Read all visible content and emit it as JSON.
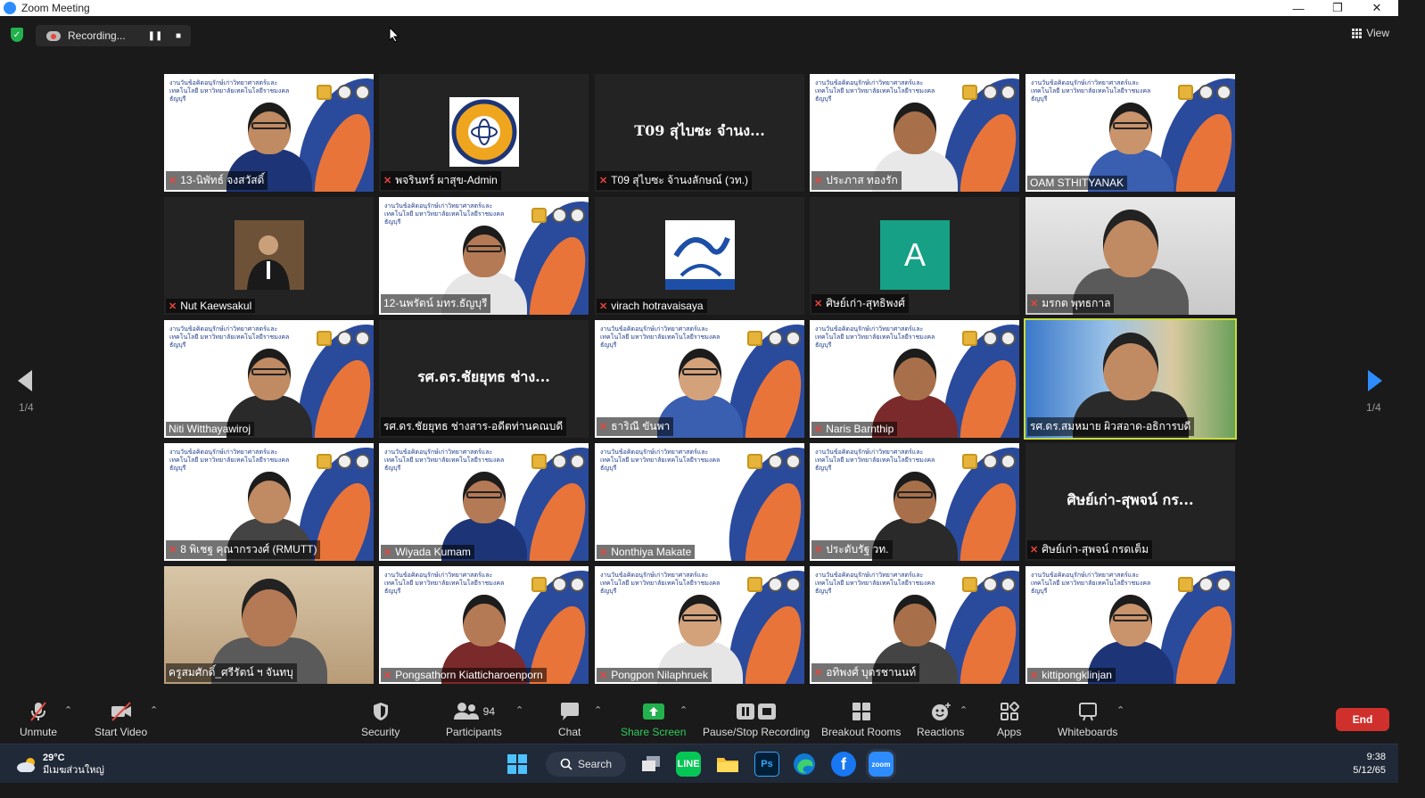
{
  "window": {
    "title": "Zoom Meeting"
  },
  "recording": {
    "status": "Recording..."
  },
  "view": {
    "label": "View"
  },
  "pagination": {
    "left": "1/4",
    "right": "1/4"
  },
  "participants": [
    {
      "name": "13-นิพัทธ์ จงสวัสดิ์",
      "muted": true,
      "kind": "slide-person"
    },
    {
      "name": "พจรินทร์ ผาสุข-Admin",
      "muted": true,
      "kind": "logo"
    },
    {
      "name": "T09 สุไบซะ จ้านงลักษณ์ (วท.)",
      "muted": true,
      "kind": "name-card",
      "card": "T09 สุไบซะ จำนง..."
    },
    {
      "name": "ประภาส ทองรัก",
      "muted": true,
      "kind": "slide-person"
    },
    {
      "name": "OAM STHITYANAK",
      "muted": false,
      "kind": "slide-person"
    },
    {
      "name": "Nut Kaewsakul",
      "muted": true,
      "kind": "photo"
    },
    {
      "name": "12-นพรัตน์ มทร.ธัญบุรี",
      "muted": false,
      "kind": "slide-person"
    },
    {
      "name": "virach hotravaisaya",
      "muted": true,
      "kind": "logo2"
    },
    {
      "name": "ศิษย์เก่า-สุทธิพงศ์",
      "muted": true,
      "kind": "avatar",
      "initial": "A"
    },
    {
      "name": "มรกต พุทธกาล",
      "muted": true,
      "kind": "camera"
    },
    {
      "name": "Niti Witthayawiroj",
      "muted": false,
      "kind": "slide-person"
    },
    {
      "name": "รศ.ดร.ชัยยุทธ ช่างสาร-อดีตท่านคณบดี",
      "muted": false,
      "kind": "name-card",
      "card": "รศ.ดร.ชัยยุทธ ช่าง..."
    },
    {
      "name": "ธาริณี ขันพา",
      "muted": true,
      "kind": "slide-person"
    },
    {
      "name": "Naris Barnthip",
      "muted": true,
      "kind": "slide-person"
    },
    {
      "name": "รศ.ดร.สมหมาย ผิวสอาด-อธิการบดี",
      "muted": false,
      "kind": "speaker"
    },
    {
      "name": "8 พิเชฐ คุณากรวงศ์ (RMUTT)",
      "muted": true,
      "kind": "slide-person"
    },
    {
      "name": "Wiyada Kumam",
      "muted": true,
      "kind": "slide-person"
    },
    {
      "name": "Nonthiya Makate",
      "muted": true,
      "kind": "slide"
    },
    {
      "name": "ประดับรัฐ วท.",
      "muted": true,
      "kind": "slide-person"
    },
    {
      "name": "ศิษย์เก่า-สุพจน์ กรดเต็ม",
      "muted": true,
      "kind": "name-card",
      "card": "ศิษย์เก่า-สุพจน์ กร..."
    },
    {
      "name": "ครูสมศักดิ์_ศรีรัตน์ ฯ จันทบุ",
      "muted": false,
      "kind": "camera"
    },
    {
      "name": "Pongsathorn Kiatticharoenporn",
      "muted": true,
      "kind": "slide-person"
    },
    {
      "name": "Pongpon Nilaphruek",
      "muted": true,
      "kind": "slide-person"
    },
    {
      "name": "อทิพงศ์ บุตรชานนท์",
      "muted": true,
      "kind": "slide-person"
    },
    {
      "name": "kittipongklinjan",
      "muted": true,
      "kind": "slide-person"
    }
  ],
  "slide_header": "งานวันข้อคิดอนุรักษ์เก่าวิทยาศาสตร์และเทคโนโลยี มหาวิทยาลัยเทคโนโลยีราชมงคลธัญบุรี",
  "toolbar": {
    "unmute": "Unmute",
    "start_video": "Start Video",
    "security": "Security",
    "participants": "Participants",
    "participants_count": "94",
    "chat": "Chat",
    "share_screen": "Share Screen",
    "recording": "Pause/Stop Recording",
    "breakout": "Breakout Rooms",
    "reactions": "Reactions",
    "apps": "Apps",
    "whiteboards": "Whiteboards",
    "end": "End"
  },
  "taskbar": {
    "temperature": "29°C",
    "weather_text": "มีเมฆส่วนใหญ่",
    "search": "Search",
    "time": "9:38",
    "date": "5/12/65"
  },
  "colors": {
    "accent_green": "#23b14d",
    "end_red": "#d0302c",
    "speaking": "#c9dc3a",
    "zoom_blue": "#2d8cff"
  }
}
